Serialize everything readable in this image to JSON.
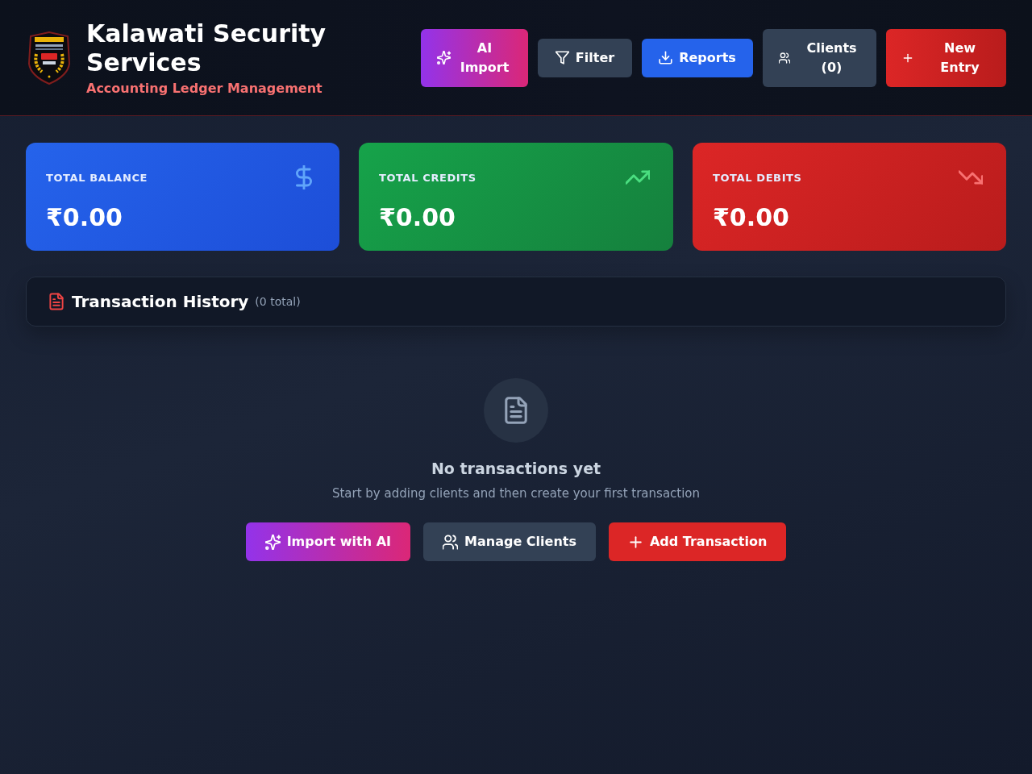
{
  "header": {
    "title": "Kalawati Security Services",
    "subtitle": "Accounting Ledger Management",
    "buttons": [
      {
        "label": "AI Import",
        "kind": "ai"
      },
      {
        "label": "Filter",
        "kind": "filter"
      },
      {
        "label": "Reports",
        "kind": "reports"
      },
      {
        "label": "Clients (0)",
        "kind": "clients"
      },
      {
        "label": "New Entry",
        "kind": "new"
      }
    ]
  },
  "stats": [
    {
      "label": "TOTAL BALANCE",
      "value": "₹0.00",
      "kind": "balance"
    },
    {
      "label": "TOTAL CREDITS",
      "value": "₹0.00",
      "kind": "credits"
    },
    {
      "label": "TOTAL DEBITS",
      "value": "₹0.00",
      "kind": "debits"
    }
  ],
  "transactions": {
    "title": "Transaction History",
    "count": "(0 total)",
    "empty_state": {
      "title": "No transactions yet",
      "message": "Start by adding clients and then create your first transaction",
      "buttons": [
        {
          "label": "Import with AI",
          "kind": "ai"
        },
        {
          "label": "Manage Clients",
          "kind": "clients"
        },
        {
          "label": "Add Transaction",
          "kind": "new"
        }
      ]
    }
  }
}
